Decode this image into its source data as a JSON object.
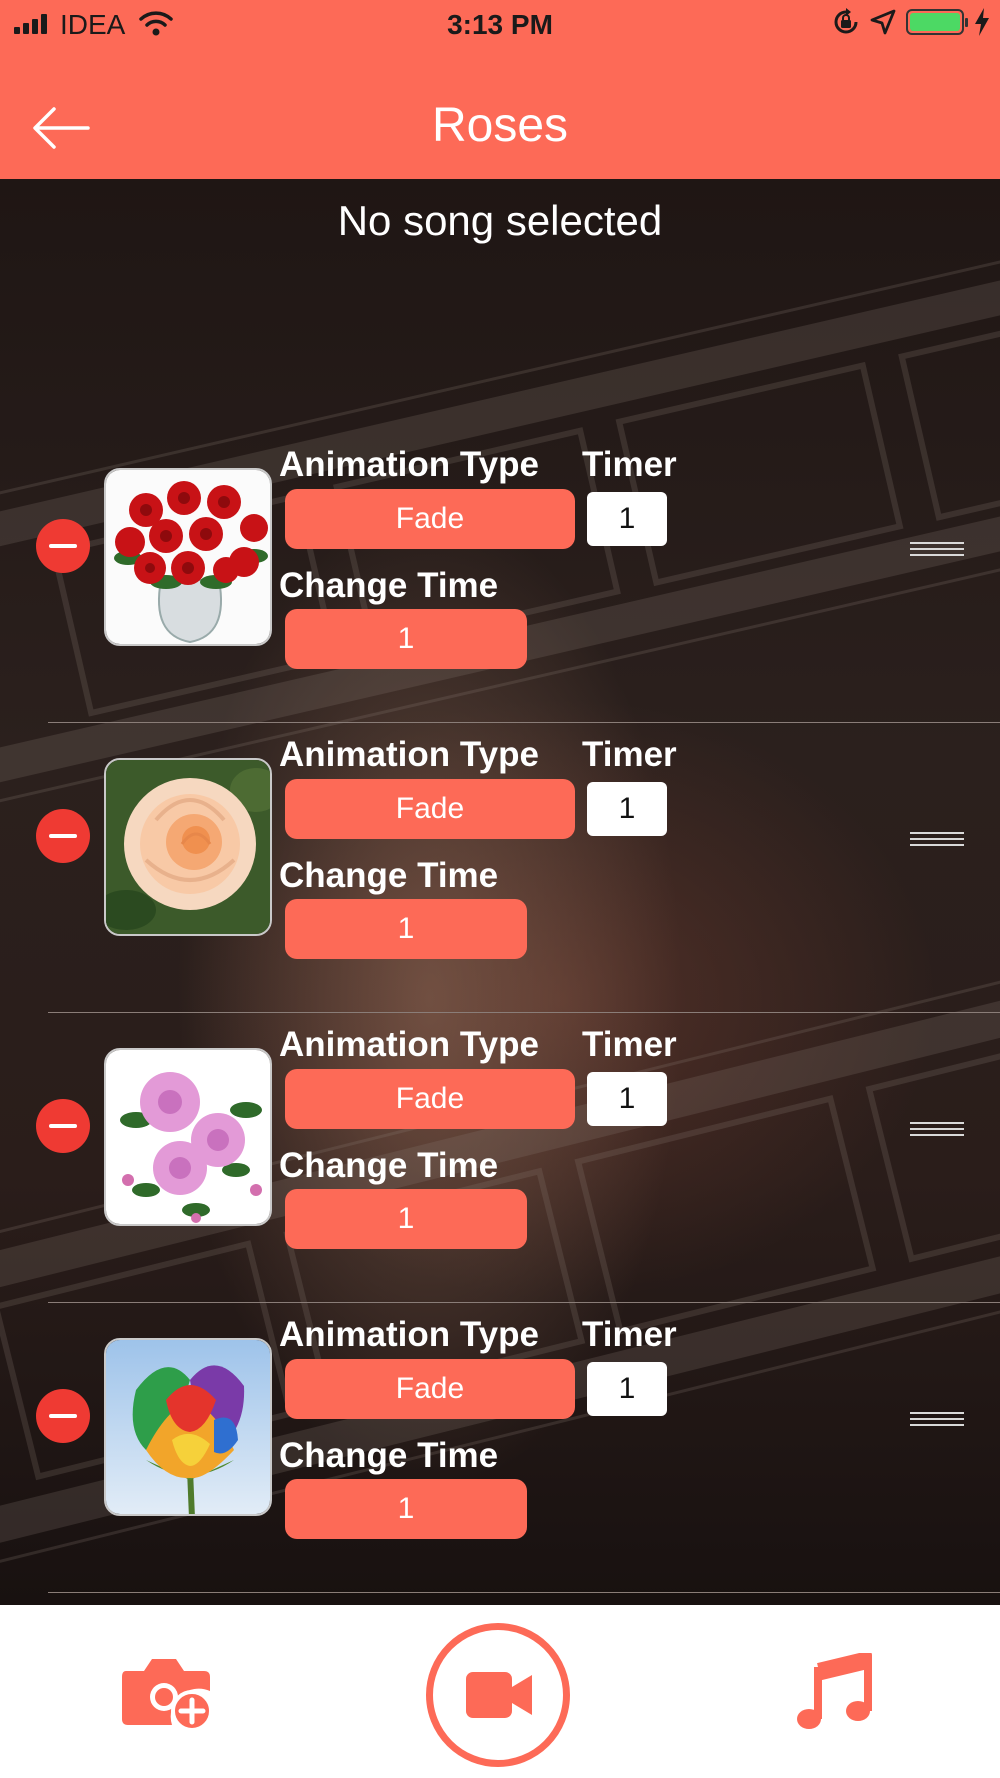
{
  "status_bar": {
    "carrier": "IDEA",
    "time": "3:13 PM",
    "battery_color": "#4cd964"
  },
  "header": {
    "title": "Roses",
    "back_icon": "arrow-left-icon",
    "background_color": "#fd6a57"
  },
  "song": {
    "label": "No song selected"
  },
  "labels": {
    "animation_type": "Animation Type",
    "timer": "Timer",
    "change_time": "Change Time"
  },
  "items": [
    {
      "image": "red-roses-bouquet",
      "animation": "Fade",
      "timer": "1",
      "change_time": "1"
    },
    {
      "image": "peach-rose",
      "animation": "Fade",
      "timer": "1",
      "change_time": "1"
    },
    {
      "image": "pink-roses",
      "animation": "Fade",
      "timer": "1",
      "change_time": "1"
    },
    {
      "image": "rainbow-rose",
      "animation": "Fade",
      "timer": "1",
      "change_time": "1"
    }
  ],
  "bottom_bar": {
    "left_icon": "add-photo-camera-icon",
    "center_icon": "video-record-icon",
    "right_icon": "music-note-icon",
    "accent_color": "#fd6a57"
  }
}
